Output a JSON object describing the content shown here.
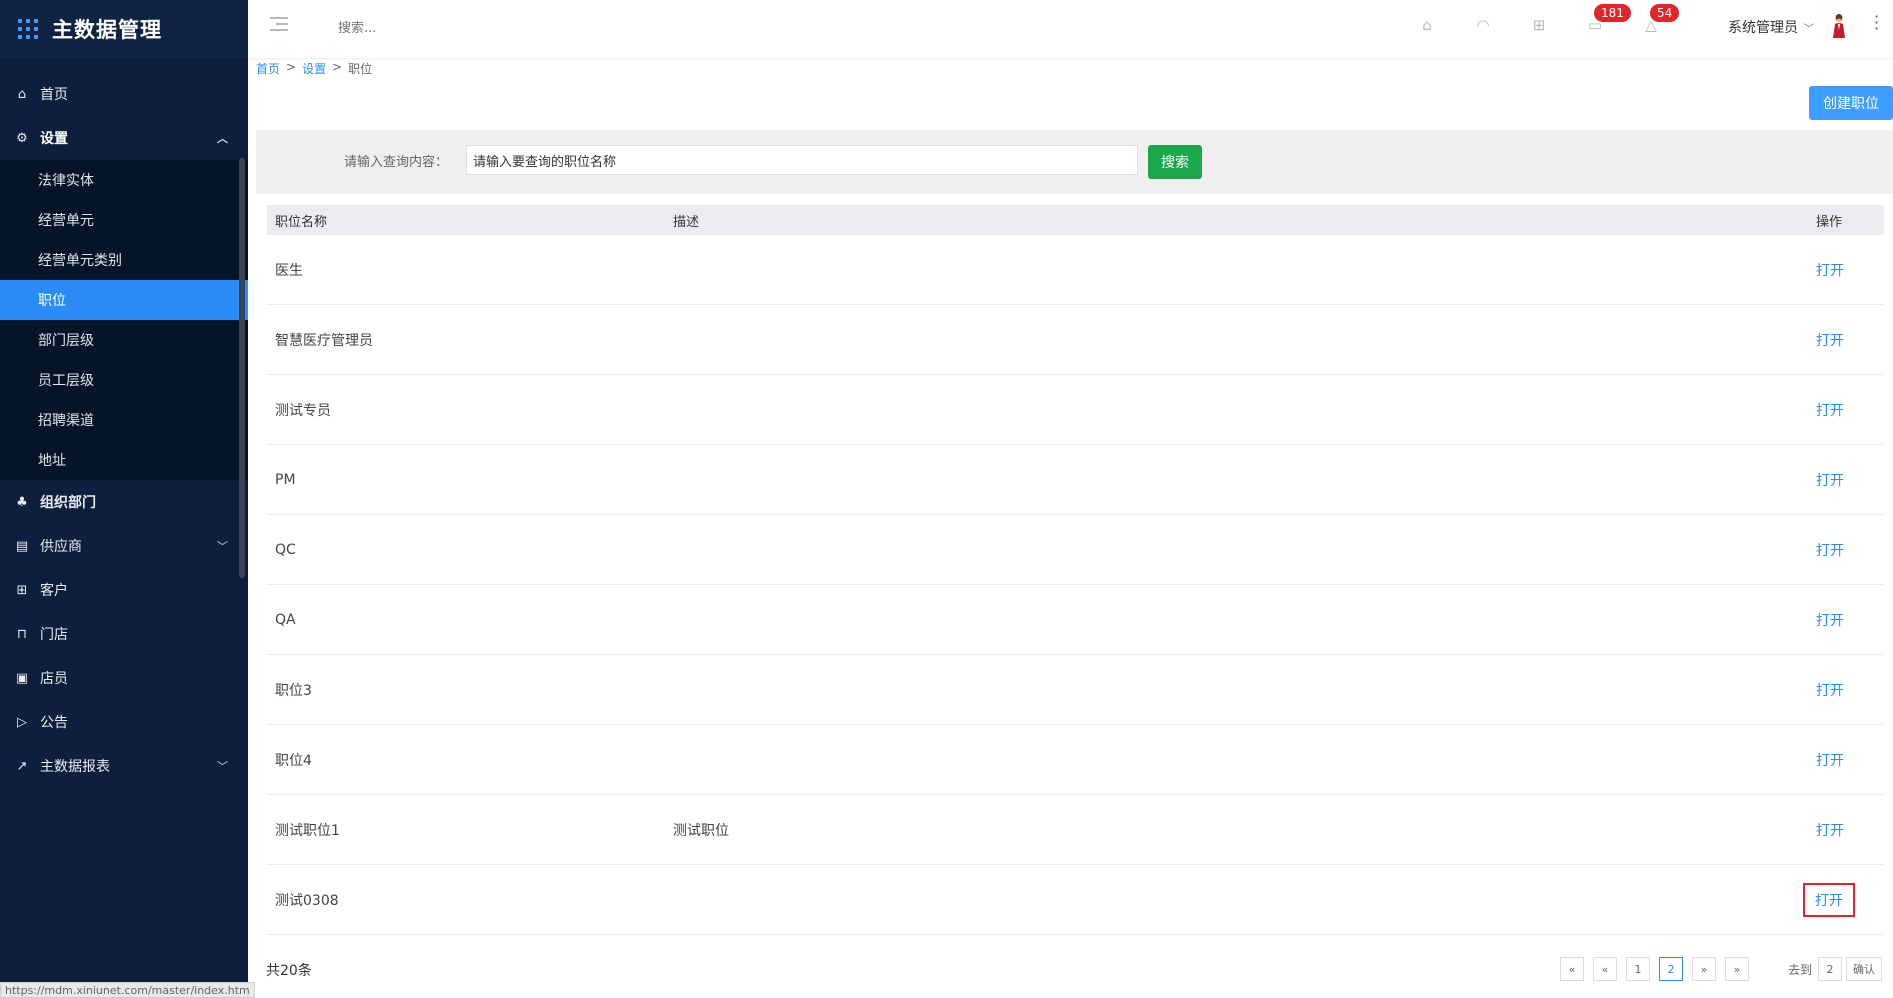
{
  "app": {
    "title": "主数据管理"
  },
  "sidebar": {
    "items": [
      {
        "label": "首页",
        "icon": "home-icon"
      },
      {
        "label": "设置",
        "icon": "gear-icon",
        "open": true,
        "children": [
          "法律实体",
          "经营单元",
          "经营单元类别",
          "职位",
          "部门层级",
          "员工层级",
          "招聘渠道",
          "地址"
        ],
        "active_child": "职位"
      },
      {
        "label": "组织部门",
        "icon": "org-icon"
      },
      {
        "label": "供应商",
        "icon": "supplier-icon",
        "expandable": true
      },
      {
        "label": "客户",
        "icon": "customer-icon"
      },
      {
        "label": "门店",
        "icon": "store-icon"
      },
      {
        "label": "店员",
        "icon": "clerk-icon"
      },
      {
        "label": "公告",
        "icon": "announce-icon"
      },
      {
        "label": "主数据报表",
        "icon": "chart-icon",
        "expandable": true
      }
    ]
  },
  "header": {
    "search_placeholder": "搜索...",
    "badge_mail": "181",
    "badge_bell": "54",
    "user_name": "系统管理员"
  },
  "breadcrumb": {
    "home": "首页",
    "settings": "设置",
    "current": "职位",
    "sep": ">"
  },
  "toolbar": {
    "create_label": "创建职位"
  },
  "search": {
    "label": "请输入查询内容：",
    "value": "请输入要查询的职位名称",
    "button": "搜索"
  },
  "table": {
    "headers": {
      "name": "职位名称",
      "desc": "描述",
      "action": "操作"
    },
    "rows": [
      {
        "name": "医生",
        "desc": "",
        "action": "打开"
      },
      {
        "name": "智慧医疗管理员",
        "desc": "",
        "action": "打开"
      },
      {
        "name": "测试专员",
        "desc": "",
        "action": "打开"
      },
      {
        "name": "PM",
        "desc": "",
        "action": "打开"
      },
      {
        "name": "QC",
        "desc": "",
        "action": "打开"
      },
      {
        "name": "QA",
        "desc": "",
        "action": "打开"
      },
      {
        "name": "职位3",
        "desc": "",
        "action": "打开"
      },
      {
        "name": "职位4",
        "desc": "",
        "action": "打开"
      },
      {
        "name": "测试职位1",
        "desc": "测试职位",
        "action": "打开"
      },
      {
        "name": "测试0308",
        "desc": "",
        "action": "打开",
        "highlighted": true
      }
    ]
  },
  "pagination": {
    "total": "共20条",
    "first": "«",
    "prev": "«",
    "pages": [
      "1",
      "2"
    ],
    "current": "2",
    "next": "»",
    "last": "»",
    "goto_label": "去到",
    "goto_value": "2",
    "confirm": "确认"
  },
  "status_url": "https://mdm.xiniunet.com/master/index.htm"
}
